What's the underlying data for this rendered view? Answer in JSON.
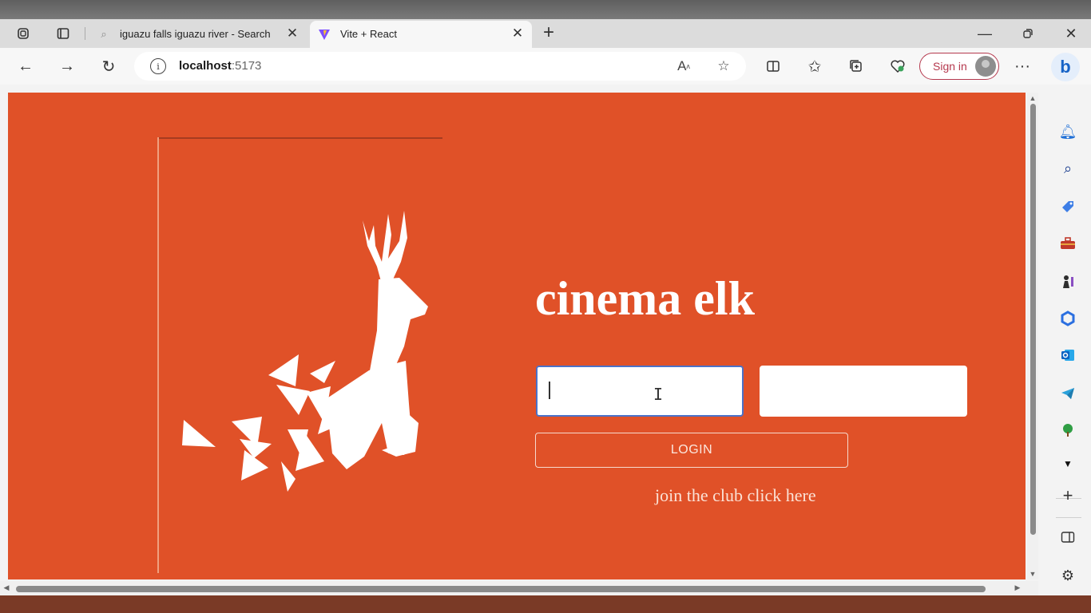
{
  "tabs": [
    {
      "label": "iguazu falls iguazu river - Search",
      "icon": "search-icon"
    },
    {
      "label": "Vite + React",
      "icon": "vite-logo-icon"
    }
  ],
  "address_bar": {
    "host": "localhost",
    "port": ":5173"
  },
  "toolbar": {
    "sign_in_label": "Sign in",
    "more": "···"
  },
  "page": {
    "title": "cinema elk",
    "username_value": "",
    "password_value": "",
    "login_label": "LOGIN",
    "join_text": "join the club click here"
  },
  "colors": {
    "page_background": "#e05128",
    "input_background": "#ffffff",
    "focused_border": "#4b72c8",
    "text_light": "#ffffff",
    "signin_accent": "#b5394e"
  },
  "sidebar_icons": [
    "bell-icon",
    "search-icon",
    "shopping-tag-icon",
    "toolbox-icon",
    "chess-icon",
    "office-icon",
    "outlook-icon",
    "telegram-icon",
    "tree-icon",
    "dropdown-icon",
    "add-icon",
    "split-screen-icon",
    "settings-icon"
  ]
}
